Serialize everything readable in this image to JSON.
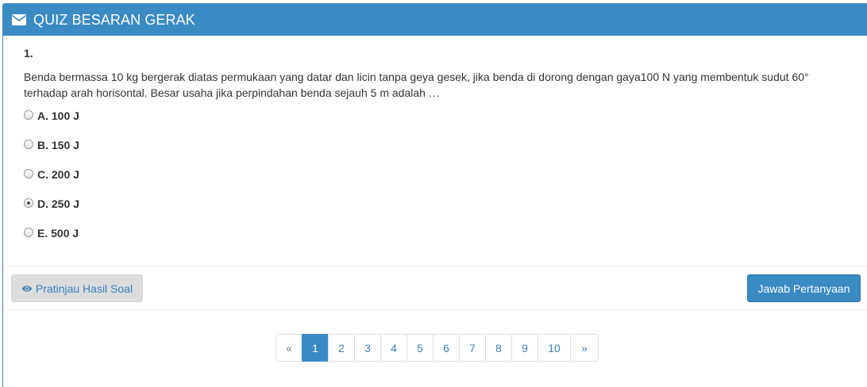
{
  "header": {
    "title": "QUIZ BESARAN GERAK",
    "icon": "envelope-icon"
  },
  "question": {
    "number": "1.",
    "text": "Benda bermassa 10 kg bergerak diatas permukaan yang datar dan licin tanpa geya gesek, jika benda di dorong dengan gaya100 N yang membentuk sudut 60° terhadap arah horisontal. Besar usaha jika perpindahan benda sejauh 5 m adalah …",
    "options": [
      {
        "label": "A. 100 J",
        "selected": false
      },
      {
        "label": "B. 150 J",
        "selected": false
      },
      {
        "label": "C. 200 J",
        "selected": false
      },
      {
        "label": "D. 250 J",
        "selected": true
      },
      {
        "label": "E. 500 J",
        "selected": false
      }
    ]
  },
  "actions": {
    "preview_label": "Pratinjau Hasil Soal",
    "preview_icon": "eye-icon",
    "answer_label": "Jawab Pertanyaan"
  },
  "pagination": {
    "prev": "«",
    "pages": [
      "1",
      "2",
      "3",
      "4",
      "5",
      "6",
      "7",
      "8",
      "9",
      "10"
    ],
    "next": "»",
    "current": "1"
  },
  "colors": {
    "primary": "#3a8ac4",
    "link": "#3a7fc0",
    "preview_button_bg": "#dcdcdc"
  }
}
